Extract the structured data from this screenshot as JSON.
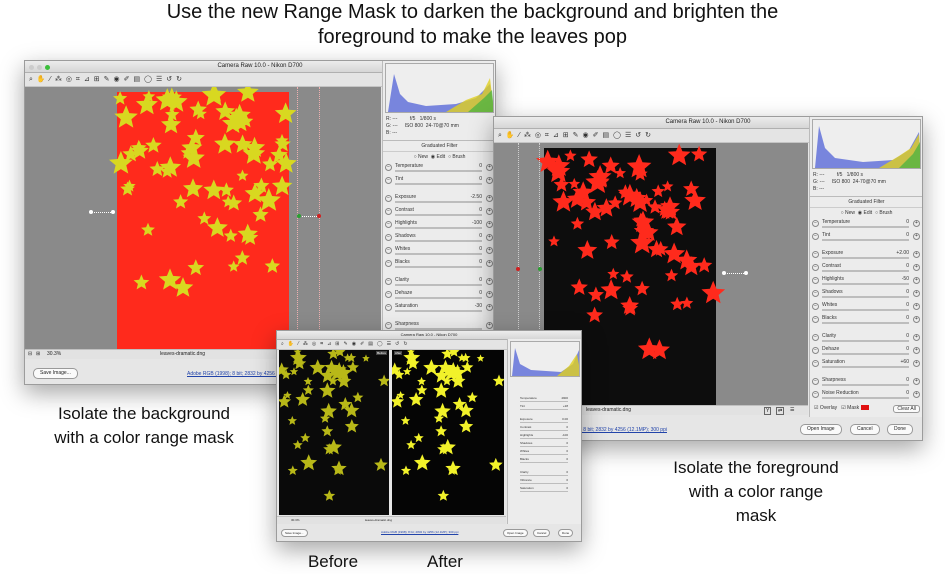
{
  "headline": {
    "line1": "Use the new Range Mask to darken the background and brighten the",
    "line2": "foreground to make the leaves pop"
  },
  "captions": {
    "left": [
      "Isolate the background",
      "with a color range mask"
    ],
    "right": [
      "Isolate the foreground",
      "with a color range",
      "mask"
    ],
    "before": "Before",
    "after": "After"
  },
  "left_window": {
    "title": "Camera Raw 10.0  -  Nikon D700",
    "toolbar_icons": [
      "zoom-icon",
      "hand-icon",
      "white-balance-icon",
      "color-sampler-icon",
      "target-adjust-icon",
      "crop-icon",
      "straighten-icon",
      "transform-icon",
      "spot-removal-icon",
      "red-eye-icon",
      "adjustment-brush-icon",
      "graduated-filter-icon",
      "radial-filter-icon",
      "presets-icon",
      "rotate-left-icon",
      "rotate-right-icon"
    ],
    "toolbar_glyphs": [
      "⌕",
      "✋",
      "⁄",
      "⁂",
      "◎",
      "⌗",
      "⊿",
      "⊞",
      "✎",
      "◉",
      "✐",
      "▤",
      "◯",
      "☰",
      "↺",
      "↻"
    ],
    "meta": {
      "r": "R:  ---",
      "g": "G:  ---",
      "b": "B:  ---",
      "aperture": "f/5",
      "shutter": "1/800 s",
      "iso": "ISO 800",
      "lens": "24-70@70 mm"
    },
    "section": "Graduated Filter",
    "modes": {
      "new": "New",
      "edit": "Edit",
      "brush": "Brush"
    },
    "sliders": [
      {
        "label": "Temperature",
        "value": "0"
      },
      {
        "label": "Tint",
        "value": "0"
      },
      {
        "label": "Exposure",
        "value": "-2.50"
      },
      {
        "label": "Contrast",
        "value": "0"
      },
      {
        "label": "Highlights",
        "value": "-100"
      },
      {
        "label": "Shadows",
        "value": "0"
      },
      {
        "label": "Whites",
        "value": "0"
      },
      {
        "label": "Blacks",
        "value": "0"
      },
      {
        "label": "Clarity",
        "value": "0"
      },
      {
        "label": "Dehaze",
        "value": "0"
      },
      {
        "label": "Saturation",
        "value": "-30"
      },
      {
        "label": "Sharpness",
        "value": ""
      }
    ],
    "zoom": "30.3%",
    "filename": "leaves-dramatic.dng",
    "save_button": "Save Image..."
  },
  "right_window": {
    "title": "Camera Raw 10.0  -  Nikon D700",
    "meta": {
      "r": "R:  ---",
      "g": "G:  ---",
      "b": "B:  ---",
      "aperture": "f/5",
      "shutter": "1/800 s",
      "iso": "ISO 800",
      "lens": "24-70@70 mm"
    },
    "section": "Graduated Filter",
    "modes": {
      "new": "New",
      "edit": "Edit",
      "brush": "Brush"
    },
    "sliders": [
      {
        "label": "Temperature",
        "value": "0"
      },
      {
        "label": "Tint",
        "value": "0"
      },
      {
        "label": "Exposure",
        "value": "+2.00"
      },
      {
        "label": "Contrast",
        "value": "0"
      },
      {
        "label": "Highlights",
        "value": "-50"
      },
      {
        "label": "Shadows",
        "value": "0"
      },
      {
        "label": "Whites",
        "value": "0"
      },
      {
        "label": "Blacks",
        "value": "0"
      },
      {
        "label": "Clarity",
        "value": "0"
      },
      {
        "label": "Dehaze",
        "value": "0"
      },
      {
        "label": "Saturation",
        "value": "+60"
      },
      {
        "label": "Sharpness",
        "value": "0"
      },
      {
        "label": "Noise Reduction",
        "value": "0"
      }
    ],
    "filename": "leaves-dramatic.dng",
    "overlay": "Overlay",
    "mask": "Mask",
    "clear_all": "Clear All",
    "profile_link": "Adobe RGB (1998); 8 bit; 2832 by 4256 (12.1MP); 300 ppi",
    "open_button": "Open Image",
    "cancel_button": "Cancel",
    "done_button": "Done"
  },
  "left_footer": {
    "profile_link": "Adobe RGB (1998); 8 bit; 2832 by 4256 (12.1MP); 300 ppi"
  },
  "small_window": {
    "title": "Camera Raw 10.0  -  Nikon D700",
    "before_label": "Before",
    "after_label": "After",
    "zoom": "30.3%",
    "filename": "leaves-dramatic.dng",
    "save_button": "Save Image...",
    "profile_link": "Adobe RGB (1998); 8 bit; 2832 by 4256 (12.1MP); 300 ppi",
    "open_button": "Open Image",
    "cancel_button": "Cancel",
    "done_button": "Done",
    "sliders": [
      {
        "label": "Temperature",
        "value": "4900"
      },
      {
        "label": "Tint",
        "value": "+28"
      },
      {
        "label": "Exposure",
        "value": "0.00"
      },
      {
        "label": "Contrast",
        "value": "0"
      },
      {
        "label": "Highlights",
        "value": "-100"
      },
      {
        "label": "Shadows",
        "value": "0"
      },
      {
        "label": "Whites",
        "value": "0"
      },
      {
        "label": "Blacks",
        "value": "0"
      },
      {
        "label": "Clarity",
        "value": "0"
      },
      {
        "label": "Vibrance",
        "value": "0"
      },
      {
        "label": "Saturation",
        "value": "0"
      }
    ]
  },
  "colors": {
    "mask_red": "#ff2a1c",
    "leaf_yellow": "#d8d820",
    "leaf_dark": "#5a5a10",
    "canvas_gray": "#8a8a8a",
    "pin_green": "#2aa030",
    "pin_red": "#d02020"
  }
}
